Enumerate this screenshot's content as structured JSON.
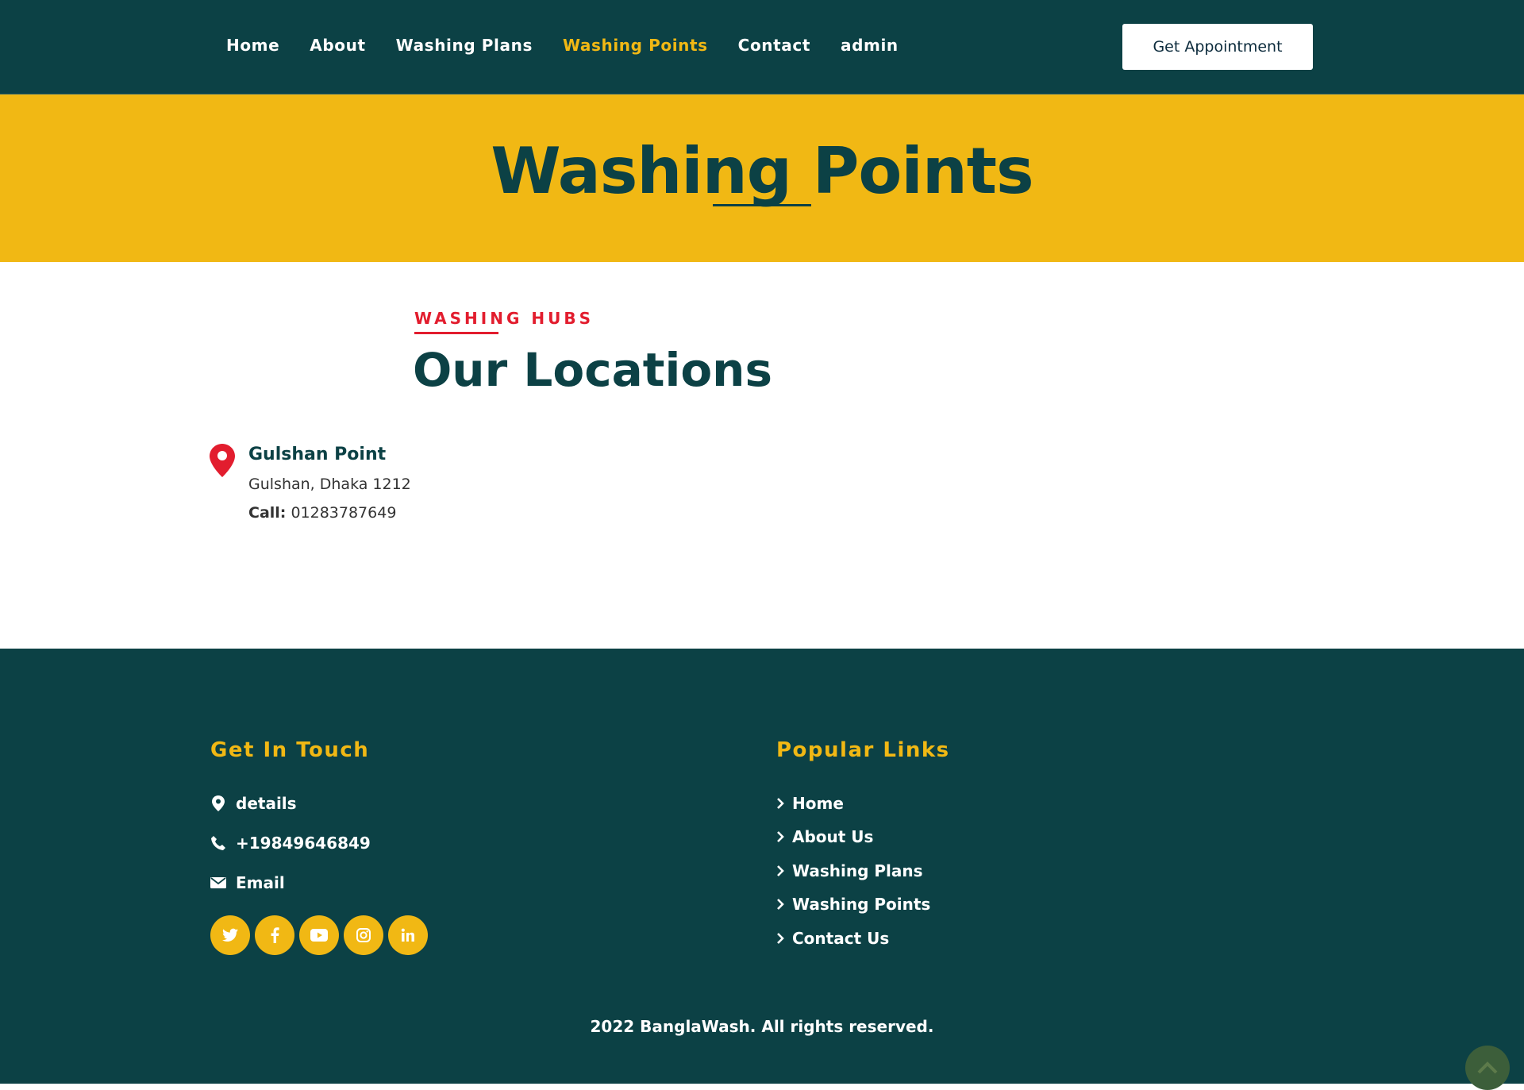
{
  "nav": {
    "links": [
      {
        "label": "Home",
        "active": false
      },
      {
        "label": "About",
        "active": false
      },
      {
        "label": "Washing Plans",
        "active": false
      },
      {
        "label": "Washing Points",
        "active": true
      },
      {
        "label": "Contact",
        "active": false
      },
      {
        "label": "admin",
        "active": false
      }
    ],
    "cta_label": "Get Appointment"
  },
  "hero": {
    "title": "Washing Points"
  },
  "locations": {
    "subtitle": "WASHING HUBS",
    "title": "Our Locations",
    "items": [
      {
        "name": "Gulshan Point",
        "address": "Gulshan, Dhaka 1212",
        "call_label": "Call:",
        "phone": "01283787649"
      }
    ]
  },
  "footer": {
    "contact": {
      "heading": "Get In Touch",
      "address": "details",
      "phone": "+19849646849",
      "email": "Email"
    },
    "socials": [
      "twitter-icon",
      "facebook-icon",
      "youtube-icon",
      "instagram-icon",
      "linkedin-icon"
    ],
    "links": {
      "heading": "Popular Links",
      "items": [
        "Home",
        "About Us",
        "Washing Plans",
        "Washing Points",
        "Contact Us"
      ]
    },
    "copyright": "2022 BanglaWash. All rights reserved."
  },
  "colors": {
    "primary": "#0c4145",
    "accent": "#f1b814",
    "highlight": "#e21d2e"
  }
}
